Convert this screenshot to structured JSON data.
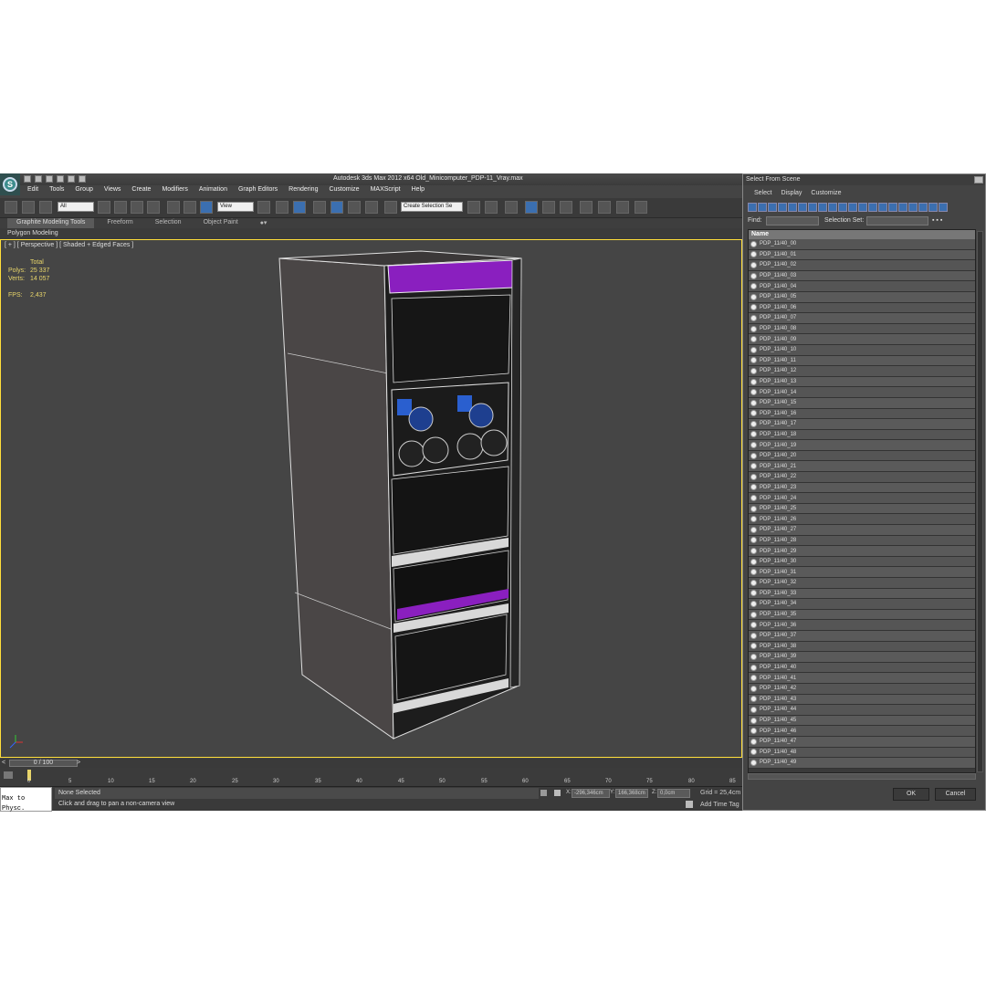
{
  "app": {
    "title": "Autodesk 3ds Max  2012 x64      Old_Minicomputer_PDP-11_Vray.max"
  },
  "menu": [
    "Edit",
    "Tools",
    "Group",
    "Views",
    "Create",
    "Modifiers",
    "Animation",
    "Graph Editors",
    "Rendering",
    "Customize",
    "MAXScript",
    "Help"
  ],
  "toolbar": {
    "filter": "All",
    "ref_coord": "View",
    "selection_set": "Create Selection Se"
  },
  "ribbon": {
    "tabs": [
      "Graphite Modeling Tools",
      "Freeform",
      "Selection",
      "Object Paint"
    ],
    "sub": "Polygon Modeling"
  },
  "viewport": {
    "label": "[ + ] [ Perspective ] [ Shaded + Edged Faces ]",
    "stats": {
      "total": "Total",
      "polys_label": "Polys:",
      "polys": "25 337",
      "verts_label": "Verts:",
      "verts": "14 057",
      "fps_label": "FPS:",
      "fps": "2,437"
    }
  },
  "timeline": {
    "slider": "0 / 100",
    "ticks": [
      "0",
      "5",
      "10",
      "15",
      "20",
      "25",
      "30",
      "35",
      "40",
      "45",
      "50",
      "55",
      "60",
      "65",
      "70",
      "75",
      "80",
      "85"
    ]
  },
  "status": {
    "maxphys": "Max to Physc.",
    "selection": "None Selected",
    "prompt": "Click and drag to pan a non-camera view",
    "x_label": "X:",
    "x": "-296,346cm",
    "y_label": "Y:",
    "y": "166,368cm",
    "z_label": "Z:",
    "z": "0,0cm",
    "grid": "Grid = 25,4cm",
    "add_time_tag": "Add Time Tag"
  },
  "dialog": {
    "title": "Select From Scene",
    "menu": [
      "Select",
      "Display",
      "Customize"
    ],
    "find_label": "Find:",
    "selection_set_label": "Selection Set:",
    "column": "Name",
    "items": [
      "PDP_11/40_00",
      "PDP_11/40_01",
      "PDP_11/40_02",
      "PDP_11/40_03",
      "PDP_11/40_04",
      "PDP_11/40_05",
      "PDP_11/40_06",
      "PDP_11/40_07",
      "PDP_11/40_08",
      "PDP_11/40_09",
      "PDP_11/40_10",
      "PDP_11/40_11",
      "PDP_11/40_12",
      "PDP_11/40_13",
      "PDP_11/40_14",
      "PDP_11/40_15",
      "PDP_11/40_16",
      "PDP_11/40_17",
      "PDP_11/40_18",
      "PDP_11/40_19",
      "PDP_11/40_20",
      "PDP_11/40_21",
      "PDP_11/40_22",
      "PDP_11/40_23",
      "PDP_11/40_24",
      "PDP_11/40_25",
      "PDP_11/40_26",
      "PDP_11/40_27",
      "PDP_11/40_28",
      "PDP_11/40_29",
      "PDP_11/40_30",
      "PDP_11/40_31",
      "PDP_11/40_32",
      "PDP_11/40_33",
      "PDP_11/40_34",
      "PDP_11/40_35",
      "PDP_11/40_36",
      "PDP_11/40_37",
      "PDP_11/40_38",
      "PDP_11/40_39",
      "PDP_11/40_40",
      "PDP_11/40_41",
      "PDP_11/40_42",
      "PDP_11/40_43",
      "PDP_11/40_44",
      "PDP_11/40_45",
      "PDP_11/40_46",
      "PDP_11/40_47",
      "PDP_11/40_48",
      "PDP_11/40_49"
    ],
    "ok": "OK",
    "cancel": "Cancel"
  },
  "colors": {
    "viewport_border": "#ffde3a",
    "cabinet_accent": "#8a1fbf",
    "stats_text": "#e8d56a"
  }
}
